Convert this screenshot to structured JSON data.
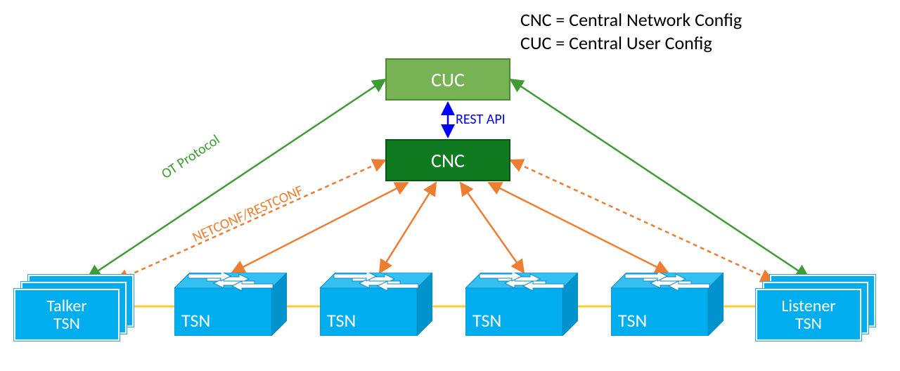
{
  "legend": {
    "line1": "CNC = Central Network Config",
    "line2": "CUC = Central User Config"
  },
  "nodes": {
    "cuc": {
      "label": "CUC",
      "fill": "#77b255",
      "stroke": "#4a8b2b"
    },
    "cnc": {
      "label": "CNC",
      "fill": "#0f7a20",
      "stroke": "#0a5515"
    },
    "talker": {
      "line1": "Talker",
      "line2": "TSN"
    },
    "listener": {
      "line1": "Listener",
      "line2": "TSN"
    },
    "switch_label": "TSN"
  },
  "edges": {
    "ot_protocol": "OT Protocol",
    "netconf": "NETCONF/RESTCONF",
    "rest_api": "REST API"
  },
  "colors": {
    "green": "#3f9c35",
    "orange": "#ed7d31",
    "blue": "#0000ff",
    "link_yellow": "#ffcc33",
    "switch_fill": "#00aeef",
    "switch_edge": "#1189c6"
  }
}
